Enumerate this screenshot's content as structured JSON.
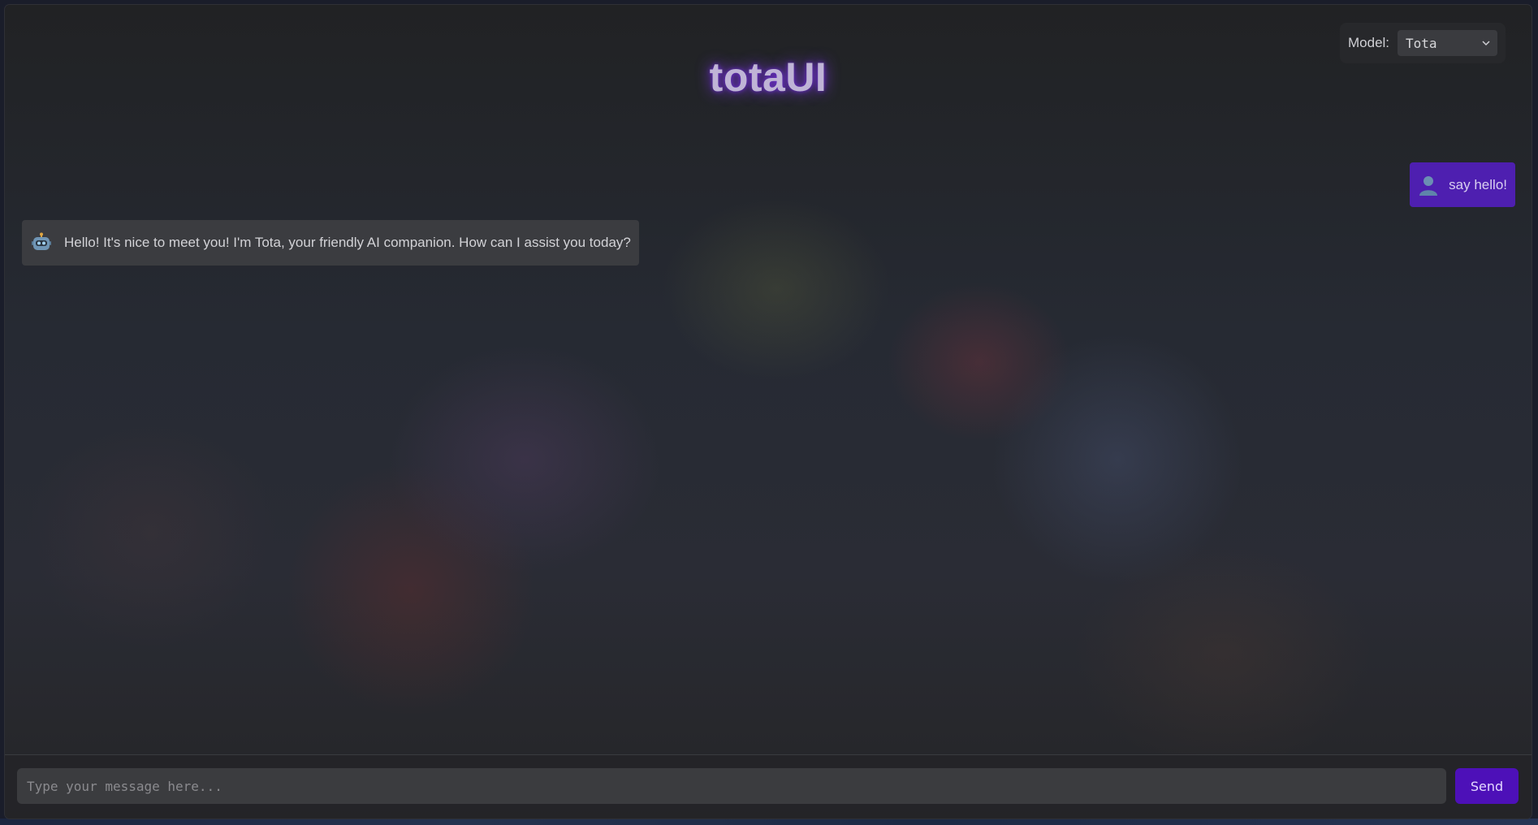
{
  "header": {
    "title": "totaUI"
  },
  "model_selector": {
    "label": "Model:",
    "selected": "Tota",
    "icon": "chevron-down-icon"
  },
  "messages": [
    {
      "role": "user",
      "avatar": "user-avatar-icon",
      "text": "say hello!"
    },
    {
      "role": "assistant",
      "avatar": "robot-avatar-icon",
      "text": "Hello! It's nice to meet you! I'm Tota, your friendly AI companion. How can I assist you today?"
    }
  ],
  "composer": {
    "placeholder": "Type your message here...",
    "value": "",
    "send_label": "Send"
  },
  "colors": {
    "accent": "#4d10b8",
    "user_bubble": "#4e1fb0",
    "assistant_bubble": "#3b3c40",
    "title_glow": "#8c3cff"
  }
}
